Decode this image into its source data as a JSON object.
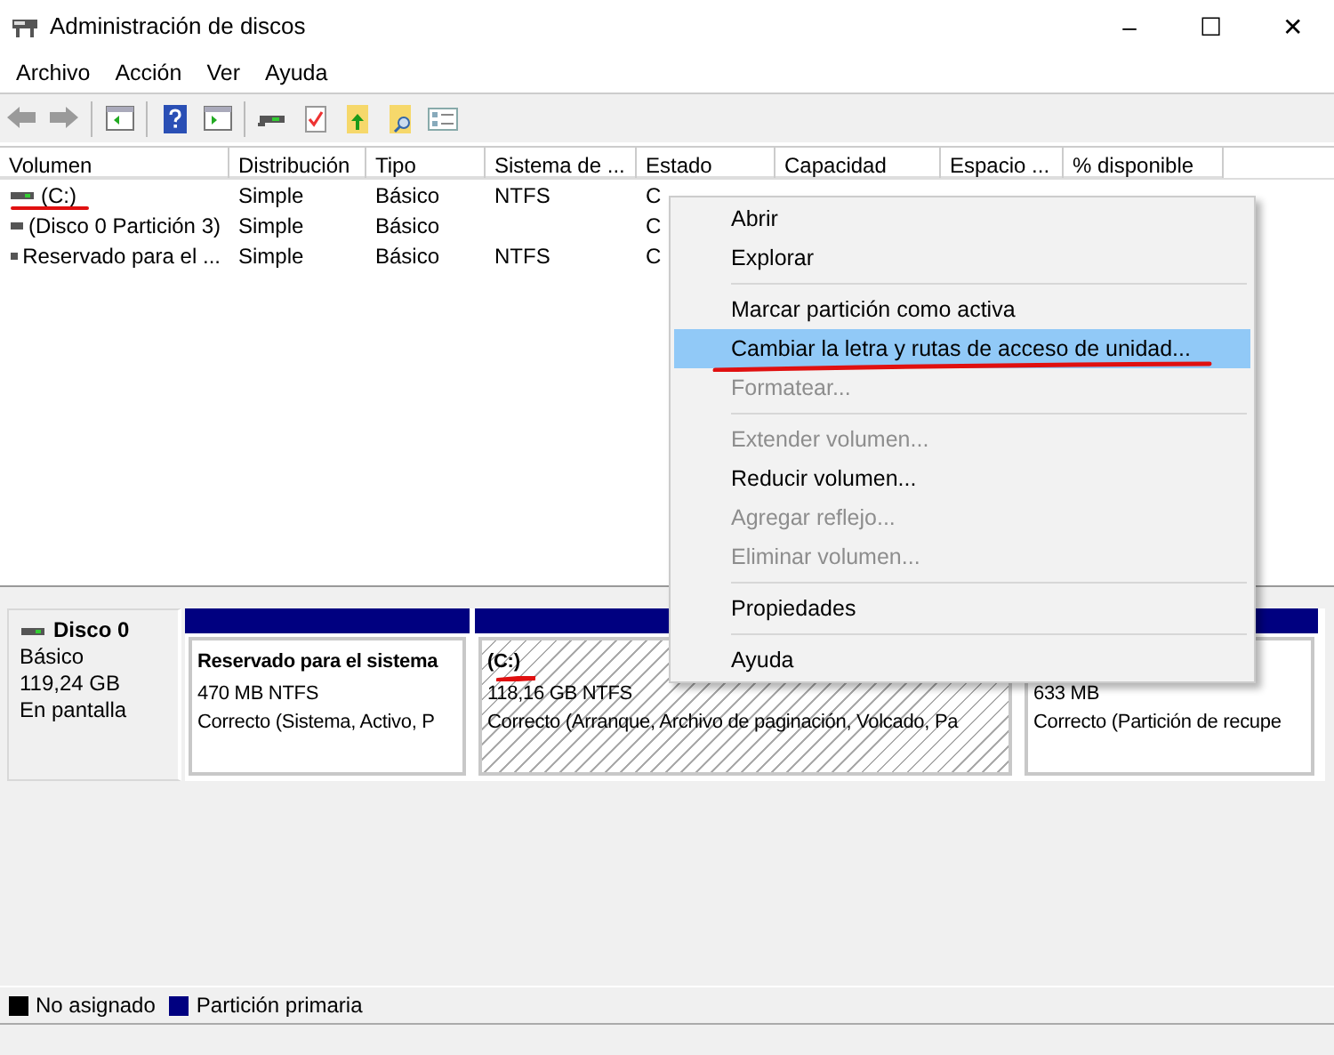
{
  "window": {
    "title": "Administración de discos",
    "controls": [
      "–",
      "☐",
      "✕"
    ]
  },
  "menu_bar": [
    "Archivo",
    "Acción",
    "Ver",
    "Ayuda"
  ],
  "table": {
    "columns": [
      "Volumen",
      "Distribución",
      "Tipo",
      "Sistema de ...",
      "Estado",
      "Capacidad",
      "Espacio ...",
      "% disponible"
    ],
    "rows": [
      {
        "cells": [
          "(C:)",
          "Simple",
          "Básico",
          "NTFS",
          "C"
        ]
      },
      {
        "cells": [
          "(Disco 0 Partición 3)",
          "Simple",
          "Básico",
          "",
          "C"
        ]
      },
      {
        "cells": [
          "Reservado para el ...",
          "Simple",
          "Básico",
          "NTFS",
          "C"
        ]
      }
    ]
  },
  "disk": {
    "name": "Disco 0",
    "type": "Básico",
    "size": "119,24 GB",
    "status": "En pantalla",
    "partitions": [
      {
        "name": "Reservado para el sistema",
        "size": "470 MB NTFS",
        "status": "Correcto (Sistema, Activo, P",
        "selected": false
      },
      {
        "name": "(C:)",
        "size": "118,16 GB NTFS",
        "status": "Correcto (Arranque, Archivo de paginación, Volcado, Pa",
        "selected": true
      },
      {
        "size": "633 MB",
        "status": "Correcto (Partición de recupe",
        "selected": false
      }
    ]
  },
  "legend": [
    {
      "label": "No asignado",
      "color": "#000000"
    },
    {
      "label": "Partición primaria",
      "color": "#000080"
    }
  ],
  "context_menu": [
    {
      "kind": "item",
      "label": "Abrir",
      "disabled": false,
      "selected": false
    },
    {
      "kind": "item",
      "label": "Explorar",
      "disabled": false,
      "selected": false
    },
    {
      "kind": "separator"
    },
    {
      "kind": "item",
      "label": "Marcar partición como activa",
      "disabled": false,
      "selected": false
    },
    {
      "kind": "item",
      "label": "Cambiar la letra y rutas de acceso de unidad...",
      "disabled": false,
      "selected": true
    },
    {
      "kind": "item",
      "label": "Formatear...",
      "disabled": true,
      "selected": false
    },
    {
      "kind": "separator"
    },
    {
      "kind": "item",
      "label": "Extender volumen...",
      "disabled": true,
      "selected": false
    },
    {
      "kind": "item",
      "label": "Reducir volumen...",
      "disabled": false,
      "selected": false
    },
    {
      "kind": "item",
      "label": "Agregar reflejo...",
      "disabled": true,
      "selected": false
    },
    {
      "kind": "item",
      "label": "Eliminar volumen...",
      "disabled": true,
      "selected": false
    },
    {
      "kind": "separator"
    },
    {
      "kind": "item",
      "label": "Propiedades",
      "disabled": false,
      "selected": false
    },
    {
      "kind": "separator"
    },
    {
      "kind": "item",
      "label": "Ayuda",
      "disabled": false,
      "selected": false
    }
  ]
}
